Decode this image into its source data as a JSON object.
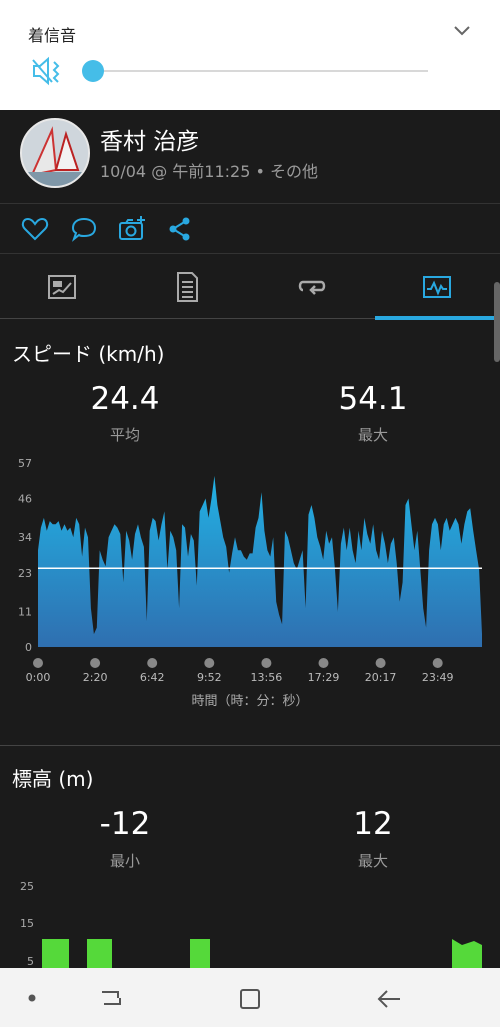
{
  "volume": {
    "title": "着信音",
    "level": 0.0,
    "icons": [
      "chevron-down-icon",
      "vibrate-speaker-icon"
    ]
  },
  "activity": {
    "user_name": "香村 治彦",
    "meta": "10/04 @ 午前11:25 • その他"
  },
  "actions": [
    "heart-icon",
    "comment-icon",
    "add-photo-icon",
    "share-icon"
  ],
  "tabs": [
    {
      "name": "summary-tab",
      "icon": "flag-chart-icon",
      "selected": false
    },
    {
      "name": "details-tab",
      "icon": "document-icon",
      "selected": false
    },
    {
      "name": "laps-tab",
      "icon": "loop-icon",
      "selected": false
    },
    {
      "name": "charts-tab",
      "icon": "activity-chart-icon",
      "selected": true
    }
  ],
  "accent_color": "#29a8e0",
  "speed": {
    "title": "スピード (km/h)",
    "avg_value": "24.4",
    "avg_label": "平均",
    "max_value": "54.1",
    "max_label": "最大",
    "xlabel": "時間（時：分：秒）"
  },
  "elevation": {
    "title": "標高 (m)",
    "min_value": "-12",
    "min_label": "最小",
    "max_value": "12",
    "max_label": "最大"
  },
  "chart_data": [
    {
      "type": "area",
      "title": "スピード (km/h)",
      "xlabel": "時間（時：分：秒）",
      "ylabel": "",
      "y_ticks": [
        "57",
        "46",
        "34",
        "23",
        "11",
        "0"
      ],
      "x_ticks": [
        "0:00",
        "2:20",
        "6:42",
        "9:52",
        "13:56",
        "17:29",
        "20:17",
        "23:49"
      ],
      "ylim": [
        0,
        57
      ],
      "average_line": 24.4,
      "grid": false,
      "series": [
        {
          "values": [
            30,
            37,
            40,
            36,
            39,
            38,
            38,
            39,
            36,
            38,
            36,
            37,
            34,
            40,
            38,
            28,
            37,
            34,
            12,
            4,
            6,
            30,
            27,
            25,
            34,
            36,
            38,
            37,
            35,
            20,
            36,
            33,
            27,
            35,
            38,
            34,
            31,
            8,
            36,
            40,
            39,
            33,
            38,
            42,
            24,
            36,
            34,
            30,
            12,
            38,
            37,
            28,
            35,
            33,
            19,
            42,
            44,
            46,
            40,
            46,
            53,
            44,
            39,
            34,
            31,
            23,
            29,
            34,
            30,
            30,
            28,
            27,
            29,
            29,
            37,
            40,
            48,
            36,
            30,
            28,
            34,
            14,
            10,
            7,
            36,
            34,
            30,
            26,
            24,
            27,
            30,
            12,
            41,
            44,
            40,
            34,
            31,
            27,
            36,
            32,
            34,
            24,
            11,
            32,
            37,
            30,
            37,
            30,
            26,
            36,
            30,
            40,
            35,
            32,
            38,
            30,
            27,
            36,
            32,
            26,
            32,
            34,
            26,
            14,
            20,
            44,
            46,
            38,
            30,
            36,
            24,
            12,
            6,
            30,
            38,
            40,
            38,
            30,
            38,
            40,
            36,
            38,
            40,
            38,
            32,
            38,
            42,
            43,
            36,
            30,
            24,
            4
          ]
        }
      ]
    },
    {
      "type": "bar",
      "title": "標高 (m)",
      "y_ticks": [
        "25",
        "15",
        "5"
      ]
    }
  ]
}
